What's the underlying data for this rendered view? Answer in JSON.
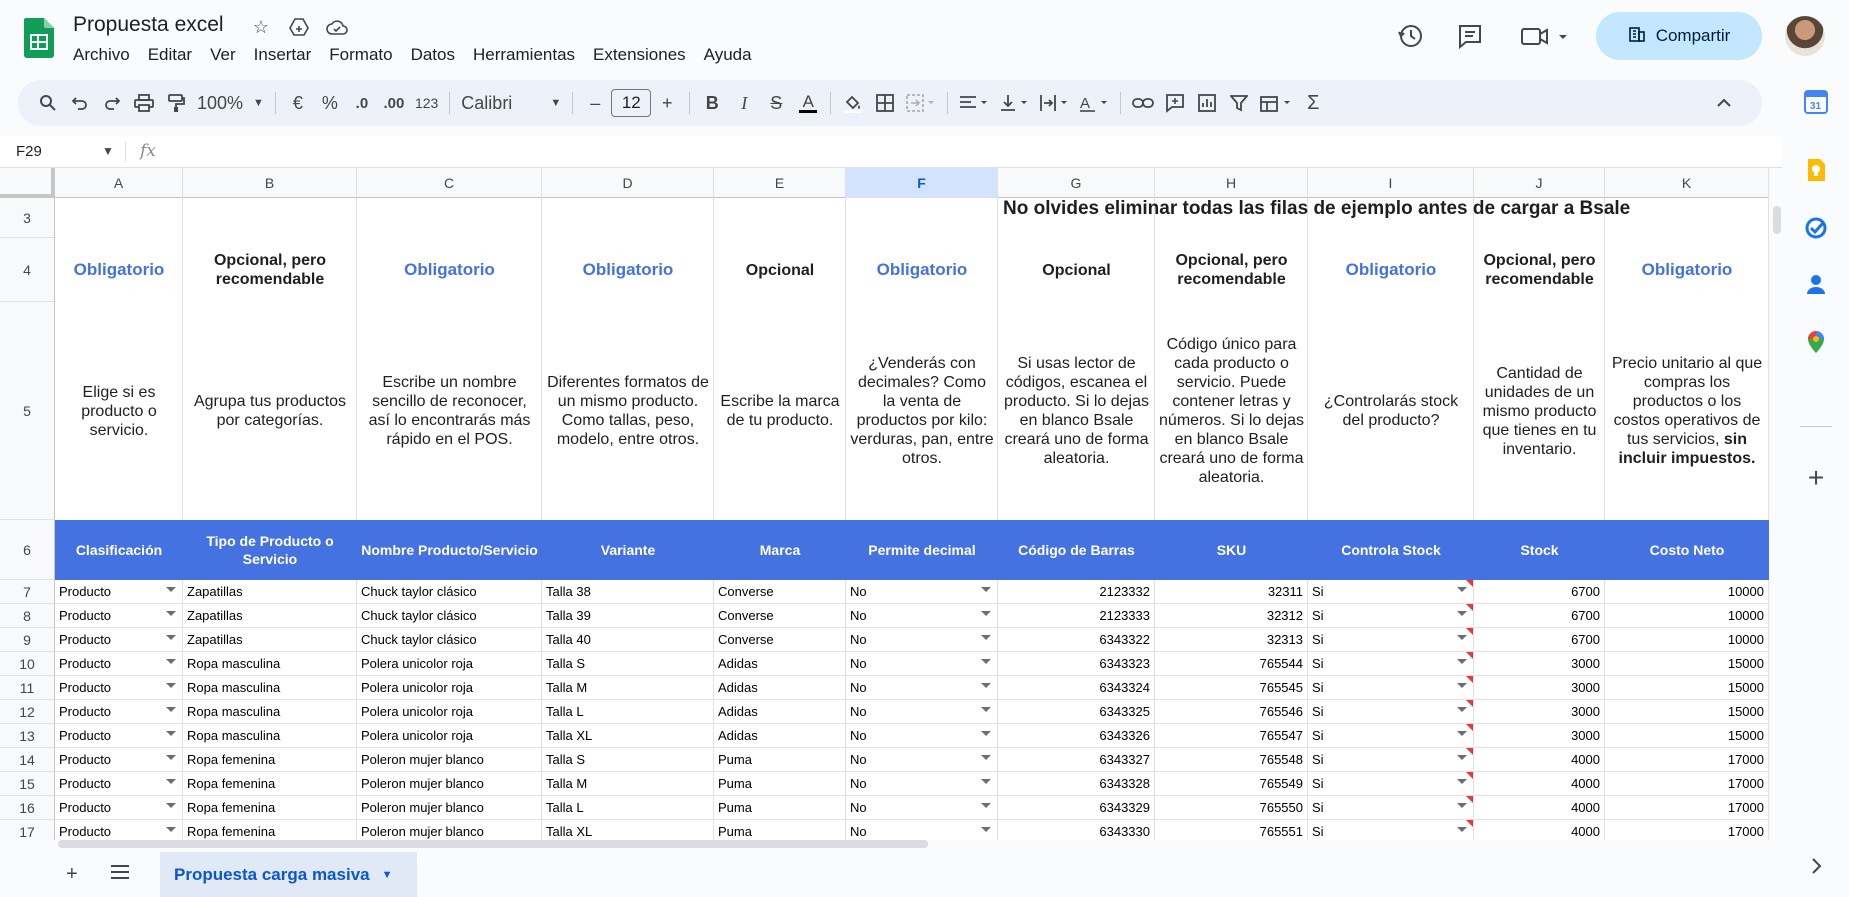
{
  "document": {
    "title": "Propuesta excel",
    "share_label": "Compartir"
  },
  "menu": [
    "Archivo",
    "Editar",
    "Ver",
    "Insertar",
    "Formato",
    "Datos",
    "Herramientas",
    "Extensiones",
    "Ayuda"
  ],
  "toolbar": {
    "zoom": "100%",
    "currency": "€",
    "percent": "%",
    "dec_less": ".0",
    "dec_more": ".00",
    "number_format": "123",
    "font": "Calibri",
    "font_size": "12"
  },
  "formula_bar": {
    "cell_ref": "F29",
    "fx": "fx"
  },
  "columns": [
    "A",
    "B",
    "C",
    "D",
    "E",
    "F",
    "G",
    "H",
    "I",
    "J",
    "K"
  ],
  "selected_column": "F",
  "row_numbers": [
    "3",
    "4",
    "5",
    "6",
    "7",
    "8",
    "9",
    "10",
    "11",
    "12",
    "13",
    "14",
    "15",
    "16",
    "17"
  ],
  "notice": "No olvides eliminar todas las filas de ejemplo antes de cargar a Bsale",
  "requirement_row": [
    "Obligatorio",
    "Opcional, pero recomendable",
    "Obligatorio",
    "Obligatorio",
    "Opcional",
    "Obligatorio",
    "Opcional",
    "Opcional, pero recomendable",
    "Obligatorio",
    "Opcional, pero recomendable",
    "Obligatorio"
  ],
  "description_row": [
    "Elige si es producto o servicio.",
    "Agrupa tus productos por categorías.",
    "Escribe un nombre sencillo de reconocer, así lo encontrarás más rápido en el POS.",
    "Diferentes formatos de un mismo producto. Como tallas, peso, modelo, entre otros.",
    "Escribe la marca de tu producto.",
    "¿Venderás con decimales? Como la venta de productos por kilo: verduras, pan, entre otros.",
    "Si usas lector de códigos, escanea el producto. Si lo dejas en blanco Bsale creará uno de forma aleatoria.",
    "Código único para cada producto o servicio. Puede contener letras y números. Si lo dejas en blanco Bsale creará uno de forma aleatoria.",
    "¿Controlarás stock del producto?",
    "Cantidad de unidades de un mismo producto que tienes en tu inventario.",
    "Precio unitario al que compras los productos o los costos operativos de tus servicios,"
  ],
  "description_k_bold": "sin incluir impuestos.",
  "headers": [
    "Clasificación",
    "Tipo de Producto o Servicio",
    "Nombre Producto/Servicio",
    "Variante",
    "Marca",
    "Permite decimal",
    "Código de Barras",
    "SKU",
    "Controla Stock",
    "Stock",
    "Costo Neto"
  ],
  "rows": [
    [
      "Producto",
      "Zapatillas",
      "Chuck taylor clásico",
      "Talla 38",
      "Converse",
      "No",
      "2123332",
      "32311",
      "Si",
      "6700",
      "10000"
    ],
    [
      "Producto",
      "Zapatillas",
      "Chuck taylor clásico",
      "Talla 39",
      "Converse",
      "No",
      "2123333",
      "32312",
      "Si",
      "6700",
      "10000"
    ],
    [
      "Producto",
      "Zapatillas",
      "Chuck taylor clásico",
      "Talla 40",
      "Converse",
      "No",
      "6343322",
      "32313",
      "Si",
      "6700",
      "10000"
    ],
    [
      "Producto",
      "Ropa masculina",
      "Polera unicolor roja",
      "Talla S",
      "Adidas",
      "No",
      "6343323",
      "765544",
      "Si",
      "3000",
      "15000"
    ],
    [
      "Producto",
      "Ropa masculina",
      "Polera unicolor roja",
      "Talla M",
      "Adidas",
      "No",
      "6343324",
      "765545",
      "Si",
      "3000",
      "15000"
    ],
    [
      "Producto",
      "Ropa masculina",
      "Polera unicolor roja",
      "Talla L",
      "Adidas",
      "No",
      "6343325",
      "765546",
      "Si",
      "3000",
      "15000"
    ],
    [
      "Producto",
      "Ropa masculina",
      "Polera unicolor roja",
      "Talla XL",
      "Adidas",
      "No",
      "6343326",
      "765547",
      "Si",
      "3000",
      "15000"
    ],
    [
      "Producto",
      "Ropa femenina",
      "Poleron mujer blanco",
      "Talla S",
      "Puma",
      "No",
      "6343327",
      "765548",
      "Si",
      "4000",
      "17000"
    ],
    [
      "Producto",
      "Ropa femenina",
      "Poleron mujer blanco",
      "Talla M",
      "Puma",
      "No",
      "6343328",
      "765549",
      "Si",
      "4000",
      "17000"
    ],
    [
      "Producto",
      "Ropa femenina",
      "Poleron mujer blanco",
      "Talla L",
      "Puma",
      "No",
      "6343329",
      "765550",
      "Si",
      "4000",
      "17000"
    ],
    [
      "Producto",
      "Ropa femenina",
      "Poleron mujer blanco",
      "Talla XL",
      "Puma",
      "No",
      "6343330",
      "765551",
      "Si",
      "4000",
      "17000"
    ]
  ],
  "sheet_tab": "Propuesta carga masiva",
  "colors": {
    "accent_blue": "#4472e0",
    "share_bg": "#c2e7ff",
    "selected_col": "#d3e3fd"
  }
}
